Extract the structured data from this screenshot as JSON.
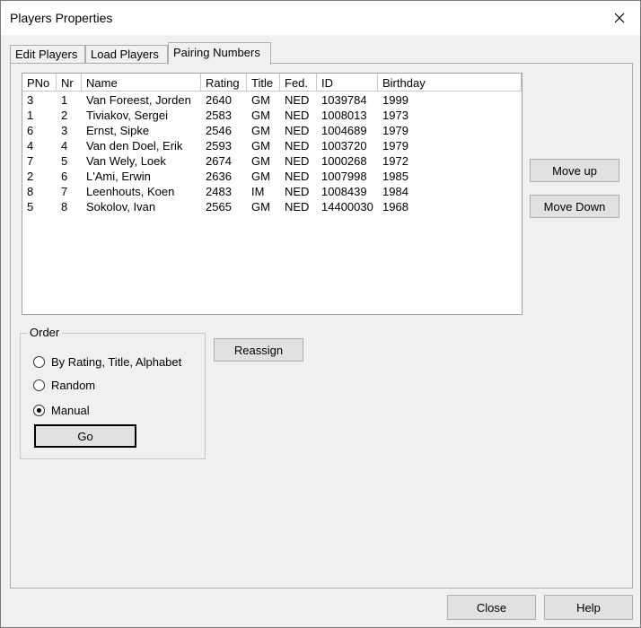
{
  "window": {
    "title": "Players Properties"
  },
  "tabs": [
    {
      "label": "Edit Players"
    },
    {
      "label": "Load Players"
    },
    {
      "label": "Pairing Numbers"
    }
  ],
  "table": {
    "columns": [
      "PNo",
      "Nr",
      "Name",
      "Rating",
      "Title",
      "Fed.",
      "ID",
      "Birthday"
    ],
    "rows": [
      [
        "3",
        "1",
        "Van Foreest, Jorden",
        "2640",
        "GM",
        "NED",
        "1039784",
        "1999"
      ],
      [
        "1",
        "2",
        "Tiviakov, Sergei",
        "2583",
        "GM",
        "NED",
        "1008013",
        "1973"
      ],
      [
        "6",
        "3",
        "Ernst, Sipke",
        "2546",
        "GM",
        "NED",
        "1004689",
        "1979"
      ],
      [
        "4",
        "4",
        "Van den Doel, Erik",
        "2593",
        "GM",
        "NED",
        "1003720",
        "1979"
      ],
      [
        "7",
        "5",
        "Van Wely, Loek",
        "2674",
        "GM",
        "NED",
        "1000268",
        "1972"
      ],
      [
        "2",
        "6",
        "L'Ami, Erwin",
        "2636",
        "GM",
        "NED",
        "1007998",
        "1985"
      ],
      [
        "8",
        "7",
        "Leenhouts, Koen",
        "2483",
        "IM",
        "NED",
        "1008439",
        "1984"
      ],
      [
        "5",
        "8",
        "Sokolov, Ivan",
        "2565",
        "GM",
        "NED",
        "14400030",
        "1968"
      ]
    ]
  },
  "side_buttons": {
    "move_up": "Move up",
    "move_down": "Move Down"
  },
  "order": {
    "legend": "Order",
    "options": [
      "By Rating, Title, Alphabet",
      "Random",
      "Manual"
    ],
    "selected": "Manual",
    "go_label": "Go"
  },
  "reassign_label": "Reassign",
  "footer": {
    "close_label": "Close",
    "help_label": "Help"
  }
}
